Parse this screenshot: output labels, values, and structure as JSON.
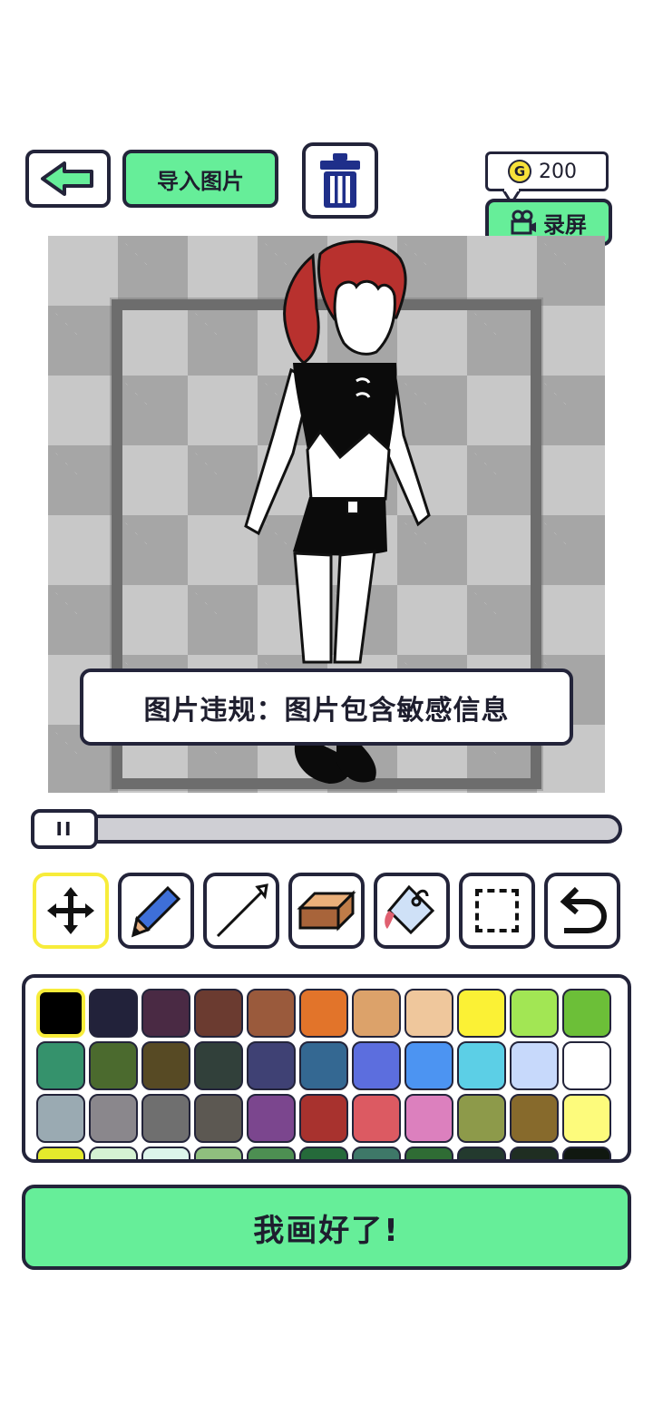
{
  "header": {
    "back_button": {
      "icon": "arrow-left-icon"
    },
    "import_label": "导入图片",
    "delete_button": {
      "icon": "trash-icon"
    },
    "coins": {
      "icon": "coin-icon",
      "badge": "G",
      "value": "200"
    },
    "record_label": "录屏"
  },
  "canvas": {
    "toast": "图片违规：图片包含敏感信息"
  },
  "slider": {
    "thumb_label": "II",
    "value": 0
  },
  "tools": [
    {
      "name": "move",
      "icon": "move-arrows-icon",
      "active": true
    },
    {
      "name": "pencil",
      "icon": "pencil-icon",
      "active": false
    },
    {
      "name": "line",
      "icon": "line-icon",
      "active": false
    },
    {
      "name": "eraser",
      "icon": "eraser-icon",
      "active": false
    },
    {
      "name": "fill",
      "icon": "paint-bucket-icon",
      "active": false
    },
    {
      "name": "select",
      "icon": "selection-box-icon",
      "active": false
    },
    {
      "name": "undo",
      "icon": "undo-icon",
      "active": false
    }
  ],
  "palette": {
    "selected_index": 0,
    "colors": [
      "#000000",
      "#22223a",
      "#4a2a44",
      "#6b3b30",
      "#9a5a3c",
      "#e2742a",
      "#dca26a",
      "#efc79c",
      "#fbf135",
      "#a2e654",
      "#6cbf38",
      "#35926c",
      "#4b6a2e",
      "#574a24",
      "#31403a",
      "#3f4174",
      "#346892",
      "#5c6ede",
      "#4c94f2",
      "#5ccfe6",
      "#c7d9fb",
      "#ffffff",
      "#9aaab2",
      "#8a878c",
      "#6f6f6f",
      "#5c5852",
      "#7b468e",
      "#a8322e",
      "#dc5a62",
      "#dc80be",
      "#8d9a4a",
      "#876a2c",
      "#fdfb7c",
      "#e4ea2c",
      "#d5f2d2",
      "#dcf5ea",
      "#8fbf7e",
      "#4d8f52",
      "#256a3a",
      "#3e7868",
      "#2f6c34",
      "#233a2e",
      "#1f2e22",
      "#101810"
    ]
  },
  "done_label": "我画好了!"
}
